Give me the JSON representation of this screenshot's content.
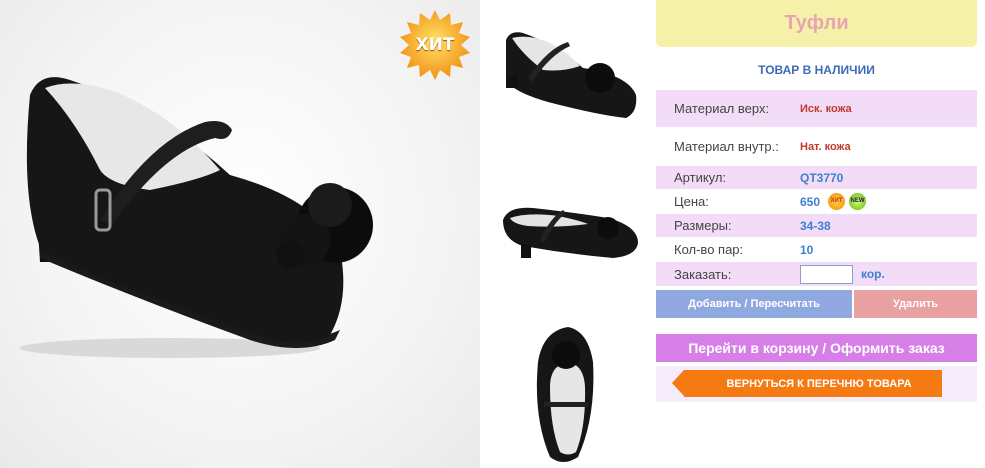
{
  "badges": {
    "hit_big": "ХИТ",
    "hit_small": "ХИТ",
    "new_small": "NEW"
  },
  "product": {
    "title": "Туфли",
    "availability": "ТОВАР В НАЛИЧИИ",
    "specs": [
      {
        "label": "Материал верх:",
        "value": "Иск. кожа"
      },
      {
        "label": "Материал внутр.:",
        "value": "Нат. кожа"
      },
      {
        "label": "Артикул:",
        "value": "QT3770"
      },
      {
        "label": "Цена:",
        "value": "650"
      },
      {
        "label": "Размеры:",
        "value": "34-38"
      },
      {
        "label": "Кол-во пар:",
        "value": "10"
      }
    ],
    "order": {
      "label": "Заказать:",
      "quantity_value": "",
      "unit": "кор."
    }
  },
  "actions": {
    "add_recalc": "Добавить / Пересчитать",
    "delete": "Удалить",
    "go_to_cart": "Перейти в корзину / Оформить заказ",
    "back_to_list": "ВЕРНУТЬСЯ К ПЕРЕЧНЮ ТОВАРА"
  },
  "colors": {
    "title_bg": "#f5f1a9",
    "title_text": "#e9a4b4",
    "row_highlight": "#f3dcf8",
    "value_blue": "#3d7fd0",
    "value_red": "#c0392b",
    "add_button": "#8fa9e0",
    "delete_button": "#e9a0a0",
    "cart_button": "#d67fe6",
    "back_button": "#f57a11"
  }
}
